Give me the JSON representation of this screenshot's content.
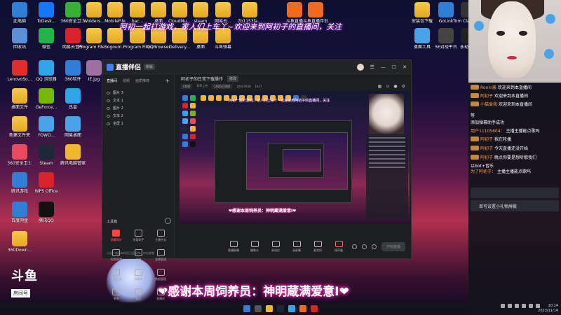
{
  "desktop": {
    "icons": [
      {
        "label": "此电脑",
        "icon": "computer-icon",
        "color": "#2f7fd6"
      },
      {
        "label": "ToDesk...",
        "icon": "todesk-icon",
        "color": "#1677ff"
      },
      {
        "label": "360安全卫士",
        "icon": "360-icon",
        "color": "#34b233"
      },
      {
        "label": "Wolders...",
        "icon": "folder-icon",
        "color": "#f1b82d"
      },
      {
        "label": "MobileFile",
        "icon": "folder-icon",
        "color": "#f1b82d"
      },
      {
        "label": "bac...",
        "icon": "folder-icon",
        "color": "#f1b82d"
      },
      {
        "label": "桌面",
        "icon": "folder-icon",
        "color": "#f1b82d"
      },
      {
        "label": "CloudMu...",
        "icon": "folder-icon",
        "color": "#f1b82d"
      },
      {
        "label": "steam",
        "icon": "folder-icon",
        "color": "#f1b82d"
      },
      {
        "label": "网易云...",
        "icon": "folder-icon",
        "color": "#f1b82d"
      },
      {
        "label": "7b1153fa...",
        "icon": "folder-icon",
        "color": "#f1b82d"
      },
      {
        "label": "回收站",
        "icon": "recycle-bin-icon",
        "color": "#5d8fd8"
      },
      {
        "label": "微信",
        "icon": "wechat-icon",
        "color": "#22b34b"
      },
      {
        "label": "网易云音乐",
        "icon": "netease-music-icon",
        "color": "#d8232a"
      },
      {
        "label": "Program Files (x86)",
        "icon": "folder-icon",
        "color": "#f1b82d"
      },
      {
        "label": "SogouIn...",
        "icon": "folder-icon",
        "color": "#f1b82d"
      },
      {
        "label": "Program Files",
        "icon": "folder-icon",
        "color": "#f1b82d"
      },
      {
        "label": "QQBrowser",
        "icon": "folder-icon",
        "color": "#f1b82d"
      },
      {
        "label": "Delivery...",
        "icon": "folder-icon",
        "color": "#f1b82d"
      },
      {
        "label": "桌面",
        "icon": "folder-icon",
        "color": "#f1b82d"
      },
      {
        "label": "斗鱼弹幕",
        "icon": "folder-icon",
        "color": "#f1b82d"
      },
      {
        "label": "LenovoSo...",
        "icon": "lenovo-icon",
        "color": "#e32d2d"
      },
      {
        "label": "QQ 浏览器",
        "icon": "qq-browser-icon",
        "color": "#2fa5ea"
      },
      {
        "label": "360软件",
        "icon": "360-soft-icon",
        "color": "#2f7fd6"
      },
      {
        "label": "IE.jpg",
        "icon": "image-icon",
        "color": "#a070a0"
      },
      {
        "label": "桌面文件",
        "icon": "folder-icon",
        "color": "#2fa06a"
      },
      {
        "label": "GeForce...",
        "icon": "geforce-icon",
        "color": "#76b900"
      },
      {
        "label": "迅雷",
        "icon": "thunder-icon",
        "color": "#2fa5ea"
      },
      {
        "label": "新建文件夹",
        "icon": "folder-icon",
        "color": "#f1b82d"
      },
      {
        "label": "YOWO...",
        "icon": "yowo-icon",
        "color": "#4aa3e8"
      },
      {
        "label": "网易桌面",
        "icon": "netease-icon",
        "color": "#4aa3e8"
      },
      {
        "label": "360安全卫士",
        "icon": "360-icon",
        "color": "#ea4a5a"
      },
      {
        "label": "Steam",
        "icon": "steam-icon",
        "color": "#1b2838"
      },
      {
        "label": "腾讯电脑管家",
        "icon": "tencent-icon",
        "color": "#f1b82d"
      },
      {
        "label": "腾讯游戏",
        "icon": "tencent-games-icon",
        "color": "#2f7fd6"
      },
      {
        "label": "WPS Office",
        "icon": "wps-icon",
        "color": "#d8232a"
      },
      {
        "label": "百度网盘",
        "icon": "baidu-pan-icon",
        "color": "#2f7fd6"
      },
      {
        "label": "腾讯QQ",
        "icon": "qq-icon",
        "color": "#111111"
      },
      {
        "label": "360Down...",
        "icon": "folder-icon",
        "color": "#f1b82d"
      },
      {
        "label": "安装包下载",
        "icon": "folder-icon",
        "color": "#f1b82d"
      },
      {
        "label": "GoLink",
        "icon": "golink-icon",
        "color": "#2f7fd6"
      },
      {
        "label": "Tom Clancy's...",
        "icon": "game-icon",
        "color": "#333333"
      },
      {
        "label": "桌面工具",
        "icon": "tool-icon",
        "color": "#4aa3e8"
      },
      {
        "label": "5E对战平台",
        "icon": "5e-icon",
        "color": "#444444"
      },
      {
        "label": "永劫无间",
        "icon": "game-icon",
        "color": "#222222"
      },
      {
        "label": "斗鱼直播",
        "icon": "douyu-icon",
        "color": "#f26b1d"
      },
      {
        "label": "斗鱼直播伴侣",
        "icon": "douyu-companion-icon",
        "color": "#f26b1d"
      }
    ]
  },
  "banners": {
    "top": "阿初一起打游戏，家人们上车丫~欢迎来到阿初子的直播间，关注",
    "bottom": "❤感谢本周饲养员：神明蔵满爱意I❤"
  },
  "douyu": {
    "logo": "斗鱼",
    "room_badge": "房间号"
  },
  "app": {
    "title": "直播伴侣",
    "version": "新版",
    "tabs": [
      "直播间",
      "视频",
      "画质推荐"
    ],
    "scenes": [
      "图片 3",
      "文本 1",
      "图片 2",
      "文本 2",
      "全屏 1"
    ],
    "tools_label": "工具箱",
    "tools": [
      {
        "label": "屏幕同步",
        "highlight": true
      },
      {
        "label": "房管助手",
        "highlight": false
      },
      {
        "label": "主播任务",
        "highlight": false
      },
      {
        "label": "视频直播",
        "highlight": false
      },
      {
        "label": "录屏",
        "highlight": false
      },
      {
        "label": "直播管理",
        "highlight": false
      },
      {
        "label": "主播工具",
        "highlight": false
      },
      {
        "label": "弹幕库",
        "highlight": false
      },
      {
        "label": "数据管理",
        "highlight": false
      },
      {
        "label": "更多",
        "highlight": false
      },
      {
        "label": "精品",
        "highlight": false
      },
      {
        "label": "直播间",
        "highlight": false
      }
    ],
    "left_footer": "公告：新版本伴侣已经发布，点击查看",
    "main_title": "阿初子的日常下载操作",
    "edit_label": "修改",
    "sub_bar": [
      "C600",
      "码率上传",
      "1920x1080",
      "16037658",
      "1417"
    ],
    "preview_banner": "阿初一起打游戏，家人们上车丫~欢迎来到阿初子的直播间，关注",
    "preview_bottom": "❤感谢本周饲养员：神明蔵满爱意I❤",
    "bottom_tools": [
      "直播屏幕",
      "摄像头",
      "多机位",
      "录屏幕",
      "麦克风",
      "扬声器"
    ],
    "start_label": "开始直播"
  },
  "chat": {
    "rows": [
      {
        "badge": true,
        "name": "Ronin酱",
        "text": "欢迎来到本直播间"
      },
      {
        "badge": true,
        "name": "阿初子",
        "text": "欢迎来到本直播间"
      },
      {
        "badge": true,
        "name": "小猫爱我",
        "text": "欢迎来到本直播间"
      },
      {
        "badge": false,
        "name": "",
        "text": "等"
      },
      {
        "badge": false,
        "name": "",
        "text": "添加弹幕助手成功"
      },
      {
        "badge": false,
        "name": "用户11105604：",
        "text": "主播主播能点歌吗"
      },
      {
        "badge": true,
        "name": "阿初子",
        "text": "我在轮播"
      },
      {
        "badge": true,
        "name": "阿初子",
        "text": "今天直播还没开始"
      },
      {
        "badge": true,
        "name": "阿初子",
        "text": "晚点你要是想听歌我们"
      },
      {
        "badge": false,
        "name": "",
        "text": "以bot+音乐"
      },
      {
        "badge": false,
        "name": "为了阿初子：",
        "text": "主播主播能点歌吗"
      }
    ],
    "input_hint": "单可设置小礼物屏蔽"
  },
  "taskbar": {
    "time": "20:14",
    "date": "2023/11/14"
  }
}
